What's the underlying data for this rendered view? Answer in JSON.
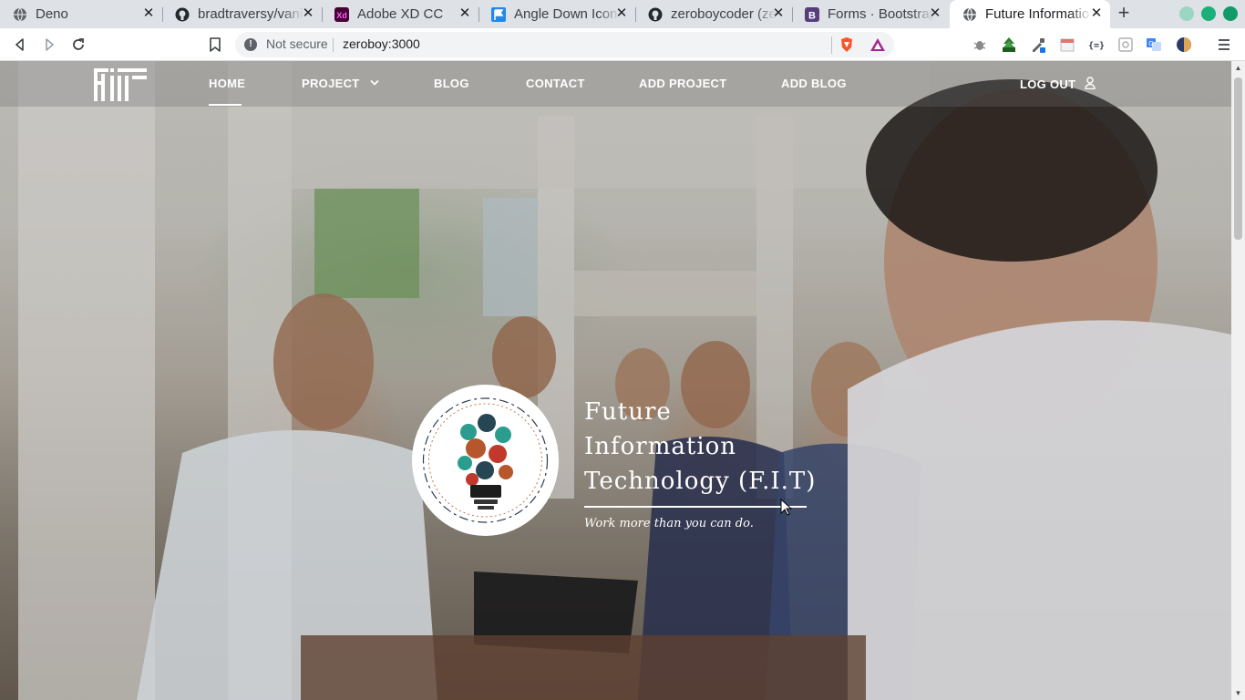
{
  "browser": {
    "tabs": [
      {
        "title": "Deno",
        "icon": "globe-icon",
        "active": false
      },
      {
        "title": "bradtraversy/vanilla",
        "icon": "github-icon",
        "active": false
      },
      {
        "title": "Adobe XD CC",
        "icon": "adobe-xd-icon",
        "active": false
      },
      {
        "title": "Angle Down Icon",
        "icon": "flag-icon",
        "active": false
      },
      {
        "title": "zeroboycoder (zeroboycoder)",
        "icon": "github-icon",
        "active": false
      },
      {
        "title": "Forms · Bootstrap",
        "icon": "bootstrap-icon",
        "active": false
      },
      {
        "title": "Future Information Technology",
        "icon": "globe-icon",
        "active": true
      }
    ],
    "new_tab": "+",
    "close_glyph": "✕",
    "security_label": "Not secure",
    "url": "zeroboy:3000",
    "colors": {
      "tab_bar": "#dee1e6",
      "omnibox": "#f1f3f4"
    }
  },
  "site": {
    "nav": {
      "home": "HOME",
      "project": "PROJECT",
      "blog": "BLOG",
      "contact": "CONTACT",
      "add_project": "ADD PROJECT",
      "add_blog": "ADD BLOG",
      "logout": "LOG OUT"
    },
    "hero": {
      "title_line1": "Future",
      "title_line2": "Information",
      "title_line3": "Technology (F.I.T)",
      "tagline": "Work more than you can do."
    }
  }
}
